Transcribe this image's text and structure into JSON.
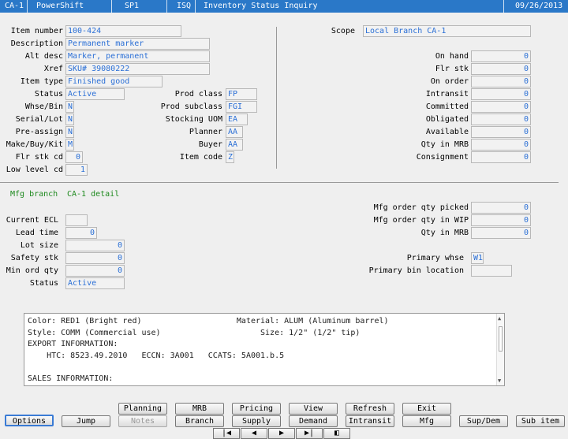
{
  "titlebar": {
    "company": "CA-1",
    "app": "PowerShift",
    "env": "SP1",
    "program": "ISQ",
    "screen_title": "Inventory Status Inquiry",
    "date": "09/26/2013"
  },
  "item": {
    "item_number_label": "Item number",
    "item_number": "100-424",
    "description_label": "Description",
    "description": "Permanent marker",
    "alt_desc_label": "Alt desc",
    "alt_desc": "Marker, permanent",
    "xref_label": "Xref",
    "xref": "SKU# 39080222",
    "item_type_label": "Item type",
    "item_type": "Finished good",
    "status_label": "Status",
    "status": "Active",
    "whse_bin_label": "Whse/Bin",
    "whse_bin": "N",
    "serial_lot_label": "Serial/Lot",
    "serial_lot": "N",
    "pre_assign_label": "Pre-assign",
    "pre_assign": "N",
    "make_buy_kit_label": "Make/Buy/Kit",
    "make_buy_kit": "M",
    "flr_stk_cd_label": "Flr stk cd",
    "flr_stk_cd": "0",
    "low_level_cd_label": "Low level cd",
    "low_level_cd": "1",
    "prod_class_label": "Prod class",
    "prod_class": "FP",
    "prod_subclass_label": "Prod subclass",
    "prod_subclass": "FGI",
    "stocking_uom_label": "Stocking UOM",
    "stocking_uom": "EA",
    "planner_label": "Planner",
    "planner": "AA",
    "buyer_label": "Buyer",
    "buyer": "AA",
    "item_code_label": "Item code",
    "item_code": "Z"
  },
  "scope": {
    "label": "Scope",
    "value": "Local Branch CA-1"
  },
  "quantities": [
    {
      "label": "On hand",
      "value": "0"
    },
    {
      "label": "Flr stk",
      "value": "0"
    },
    {
      "label": "On order",
      "value": "0"
    },
    {
      "label": "Intransit",
      "value": "0"
    },
    {
      "label": "Committed",
      "value": "0"
    },
    {
      "label": "Obligated",
      "value": "0"
    },
    {
      "label": "Available",
      "value": "0"
    },
    {
      "label": "Qty in MRB",
      "value": "0"
    },
    {
      "label": "Consignment",
      "value": "0"
    }
  ],
  "mfg": {
    "branch_label": "Mfg branch",
    "branch_detail": "CA-1 detail",
    "current_ecl_label": "Current ECL",
    "current_ecl": "",
    "lead_time_label": "Lead time",
    "lead_time": "0",
    "lot_size_label": "Lot size",
    "lot_size": "0",
    "safety_stk_label": "Safety stk",
    "safety_stk": "0",
    "min_ord_qty_label": "Min ord qty",
    "min_ord_qty": "0",
    "status_label": "Status",
    "status": "Active",
    "picked_label": "Mfg order qty picked",
    "picked": "0",
    "in_wip_label": "Mfg order qty in WIP",
    "in_wip": "0",
    "qty_in_mrb_label": "Qty in MRB",
    "qty_in_mrb": "0",
    "primary_whse_label": "Primary whse",
    "primary_whse": "W1",
    "primary_bin_label": "Primary bin location",
    "primary_bin": ""
  },
  "notes_lines": [
    "Color: RED1 (Bright red)                    Material: ALUM (Aluminum barrel)",
    "Style: COMM (Commercial use)                     Size: 1/2\" (1/2\" tip)",
    "EXPORT INFORMATION:",
    "    HTC: 8523.49.2010   ECCN: 3A001   CCATS: 5A001.b.5",
    "",
    "SALES INFORMATION:"
  ],
  "buttons": {
    "planning": "Planning",
    "mrb": "MRB",
    "pricing": "Pricing",
    "view": "View",
    "refresh": "Refresh",
    "exit": "Exit",
    "options": "Options",
    "jump": "Jump",
    "notes": "Notes",
    "branch": "Branch",
    "supply": "Supply",
    "demand": "Demand",
    "intransit": "Intransit",
    "mfg": "Mfg",
    "sup_dem": "Sup/Dem",
    "sub_item": "Sub item"
  },
  "nav": {
    "first": "|◀",
    "prev": "◀",
    "next": "▶",
    "last": "▶|",
    "toggle": "◧"
  }
}
